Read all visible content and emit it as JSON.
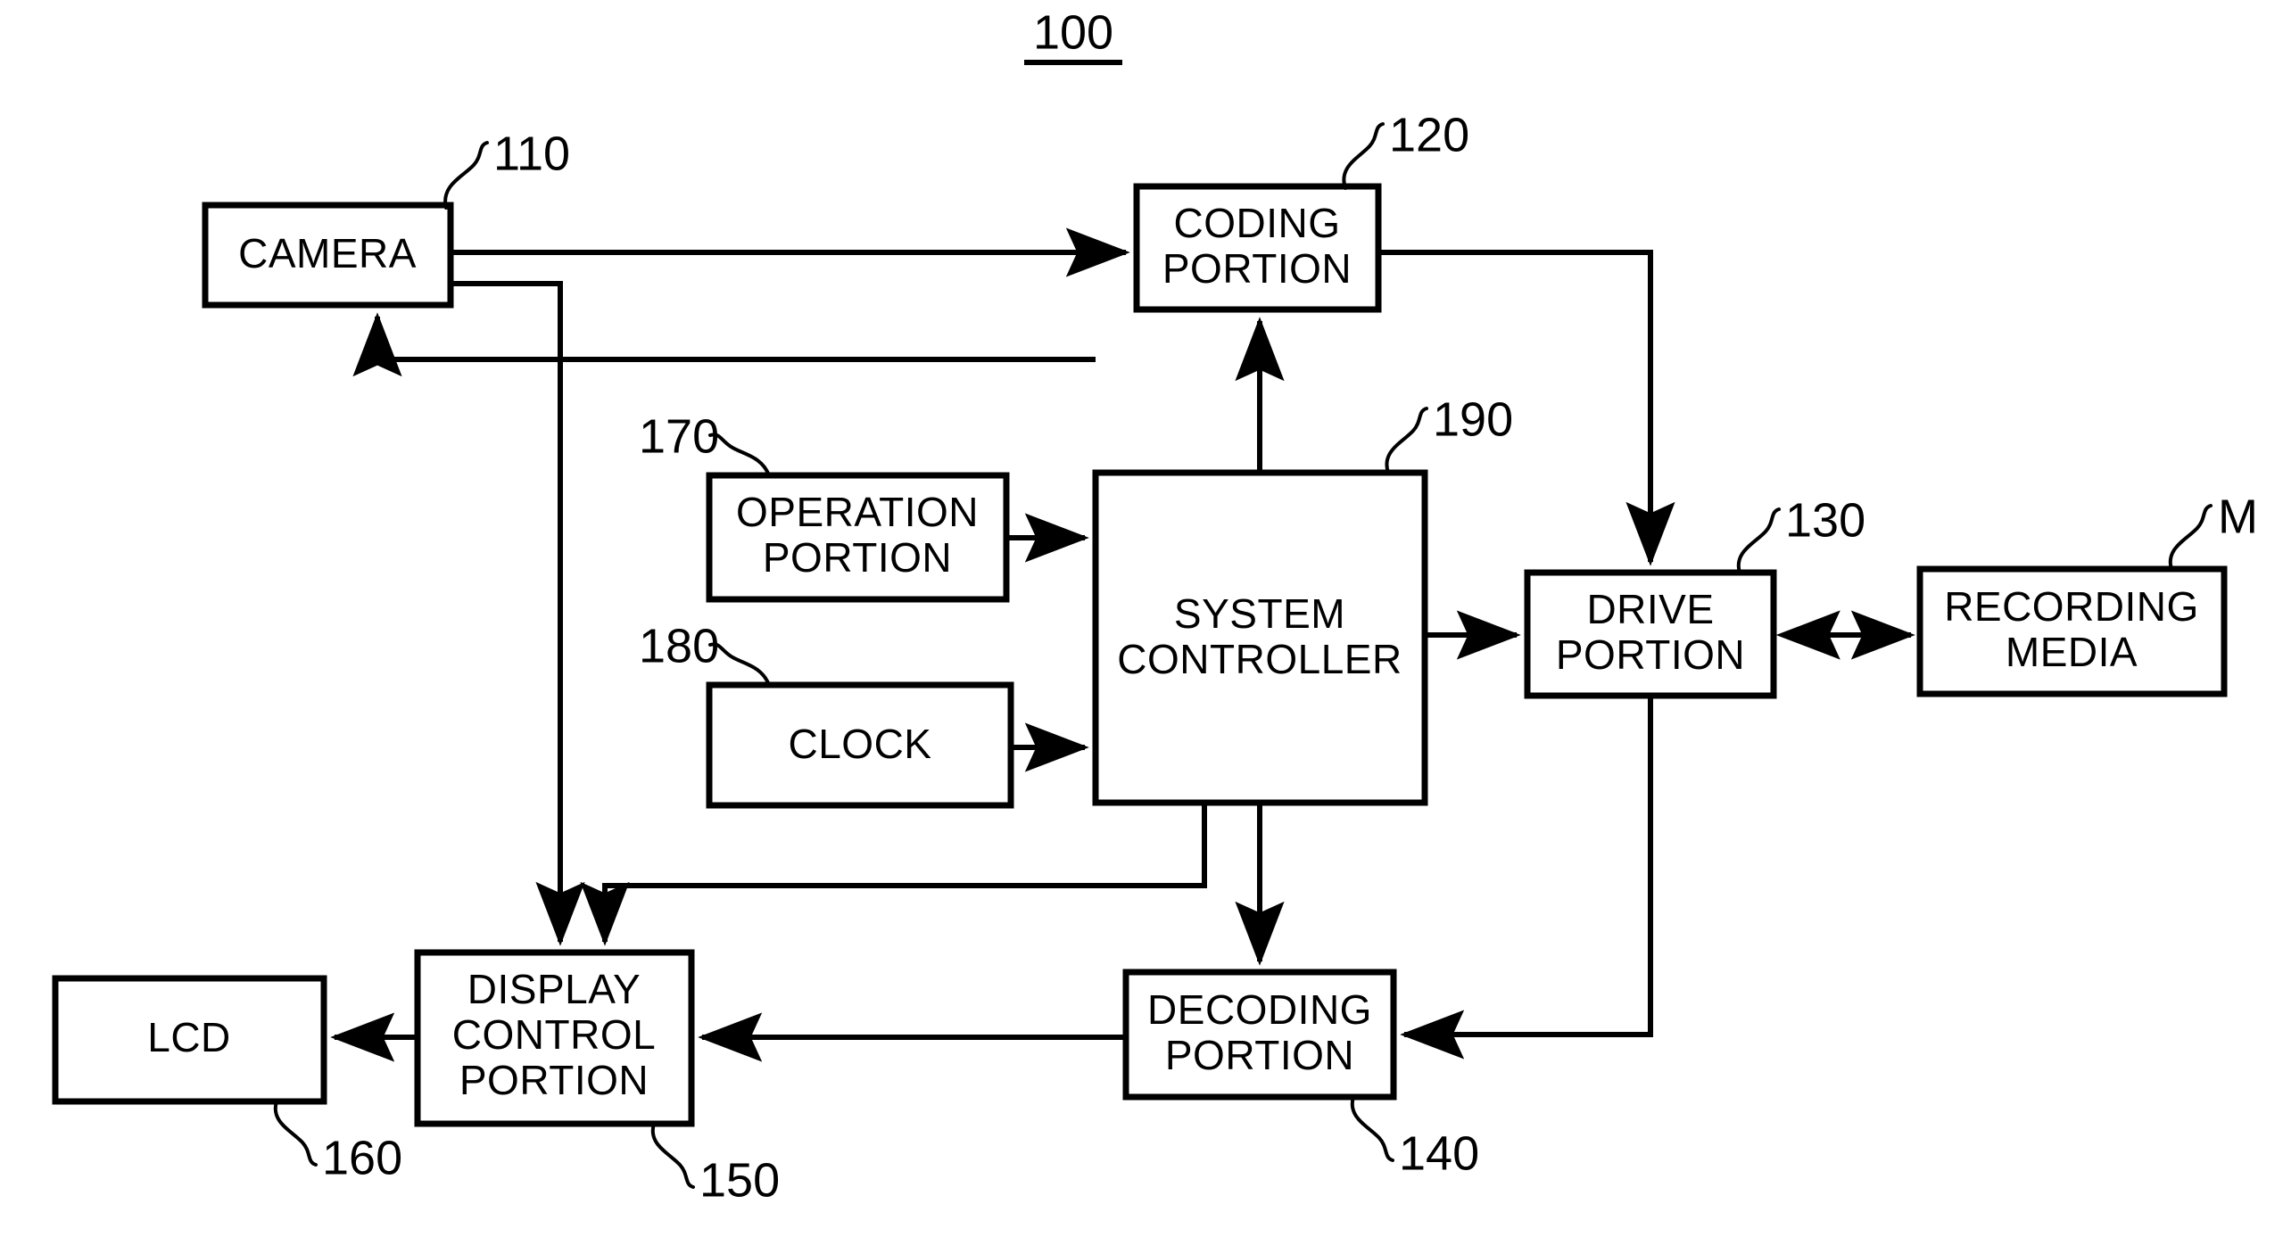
{
  "figure": {
    "number": "100",
    "boxes": [
      {
        "id": "camera",
        "label_lines": [
          "CAMERA"
        ],
        "ref": "110"
      },
      {
        "id": "coding_portion",
        "label_lines": [
          "CODING",
          "PORTION"
        ],
        "ref": "120"
      },
      {
        "id": "operation_portion",
        "label_lines": [
          "OPERATION",
          "PORTION"
        ],
        "ref": "170"
      },
      {
        "id": "clock",
        "label_lines": [
          "CLOCK"
        ],
        "ref": "180"
      },
      {
        "id": "system_controller",
        "label_lines": [
          "SYSTEM",
          "CONTROLLER"
        ],
        "ref": "190"
      },
      {
        "id": "drive_portion",
        "label_lines": [
          "DRIVE",
          "PORTION"
        ],
        "ref": "130"
      },
      {
        "id": "recording_media",
        "label_lines": [
          "RECORDING",
          "MEDIA"
        ],
        "ref": "M"
      },
      {
        "id": "decoding_portion",
        "label_lines": [
          "DECODING",
          "PORTION"
        ],
        "ref": "140"
      },
      {
        "id": "display_control",
        "label_lines": [
          "DISPLAY",
          "CONTROL",
          "PORTION"
        ],
        "ref": "150"
      },
      {
        "id": "lcd",
        "label_lines": [
          "LCD"
        ],
        "ref": "160"
      }
    ],
    "connections": [
      {
        "from": "camera",
        "to": "coding_portion",
        "arrow": "single"
      },
      {
        "from": "camera",
        "to": "display_control",
        "arrow": "single"
      },
      {
        "from": "system_controller",
        "to": "camera",
        "arrow": "single"
      },
      {
        "from": "system_controller",
        "to": "coding_portion",
        "arrow": "single"
      },
      {
        "from": "operation_portion",
        "to": "system_controller",
        "arrow": "single"
      },
      {
        "from": "clock",
        "to": "system_controller",
        "arrow": "single"
      },
      {
        "from": "system_controller",
        "to": "drive_portion",
        "arrow": "single"
      },
      {
        "from": "system_controller",
        "to": "decoding_portion",
        "arrow": "single"
      },
      {
        "from": "system_controller",
        "to": "display_control",
        "arrow": "single"
      },
      {
        "from": "coding_portion",
        "to": "drive_portion",
        "arrow": "single"
      },
      {
        "from": "drive_portion",
        "to": "recording_media",
        "arrow": "double"
      },
      {
        "from": "drive_portion",
        "to": "decoding_portion",
        "arrow": "single"
      },
      {
        "from": "decoding_portion",
        "to": "display_control",
        "arrow": "single"
      },
      {
        "from": "display_control",
        "to": "lcd",
        "arrow": "single"
      }
    ]
  },
  "colors": {
    "ink": "#000000",
    "paper": "#ffffff"
  }
}
